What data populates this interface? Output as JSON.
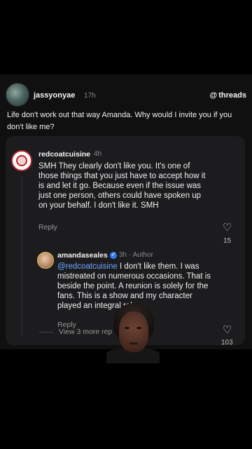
{
  "post": {
    "username": "jassyonyae",
    "time": "17h",
    "brand": "threads",
    "text": "Life don't work out that way Amanda. Why would I invite you if you don't like me?"
  },
  "reply1": {
    "username": "redcoatcuisine",
    "time": "4h",
    "text": "SMH They clearly don't like you. It's one of those things that you just have to accept how it is and let it go. Because even if the issue was just one person, others could have spoken up on your behalf. I don't like it. SMH",
    "reply_label": "Reply",
    "likes": "15"
  },
  "reply2": {
    "username": "amandaseales",
    "time": "3h · Author",
    "mention": "@redcoatcuisine",
    "text": " I don't like them. I was mistreated on numerous occasions. That is beside the point. A reunion is solely for the fans. This is a show and my character played an integral role.",
    "reply_label": "Reply",
    "likes": "103"
  },
  "view_more": "View 3 more rep",
  "colors": {
    "accent_link": "#6fa8ff",
    "verified": "#2f7bf5",
    "card_bg": "#1c1c1e",
    "post_bg": "#101010"
  },
  "icons": {
    "like": "heart-icon",
    "verified": "verified-badge-icon",
    "brand": "threads-logo-icon"
  }
}
